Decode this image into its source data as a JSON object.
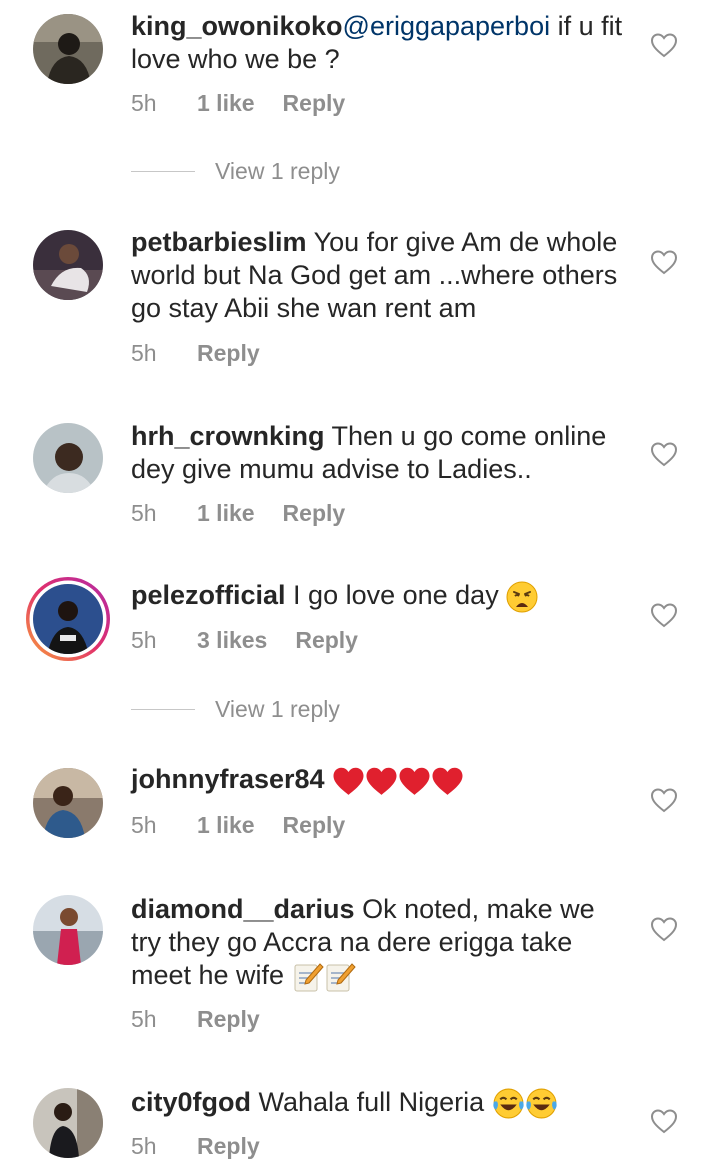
{
  "comments": [
    {
      "username": "king_owonikoko",
      "mention": "@eriggapaperboi",
      "text": " if u fit love who we be ?",
      "time": "5h",
      "likes": "1 like",
      "reply": "Reply",
      "view_replies": "View 1 reply"
    },
    {
      "username": "petbarbieslim",
      "text": " You for give Am de whole world but Na God get am ...where others go stay Abii she wan rent am",
      "time": "5h",
      "reply": "Reply"
    },
    {
      "username": "hrh_crownking",
      "text": " Then u go come online dey give mumu advise to Ladies..",
      "time": "5h",
      "likes": "1 like",
      "reply": "Reply"
    },
    {
      "username": "pelezofficial",
      "text": " I go love one day ",
      "emoji": "weary-face-emoji",
      "time": "5h",
      "likes": "3 likes",
      "reply": "Reply",
      "view_replies": "View 1 reply"
    },
    {
      "username": "johnnyfraser84",
      "text": " ",
      "emoji": "red-heart-emoji x4",
      "time": "5h",
      "likes": "1 like",
      "reply": "Reply"
    },
    {
      "username": "diamond__darius",
      "text": " Ok noted, make we try they go Accra na dere erigga take meet he wife ",
      "emoji": "memo-emoji x2",
      "time": "5h",
      "reply": "Reply"
    },
    {
      "username": "city0fgod",
      "text": " Wahala full Nigeria ",
      "emoji": "laughing-tears-emoji x2",
      "time": "5h",
      "reply": "Reply"
    }
  ],
  "colors": {
    "text": "#262626",
    "meta": "#8e8e8e",
    "mention": "#003569",
    "heart_red": "#e0202e"
  }
}
